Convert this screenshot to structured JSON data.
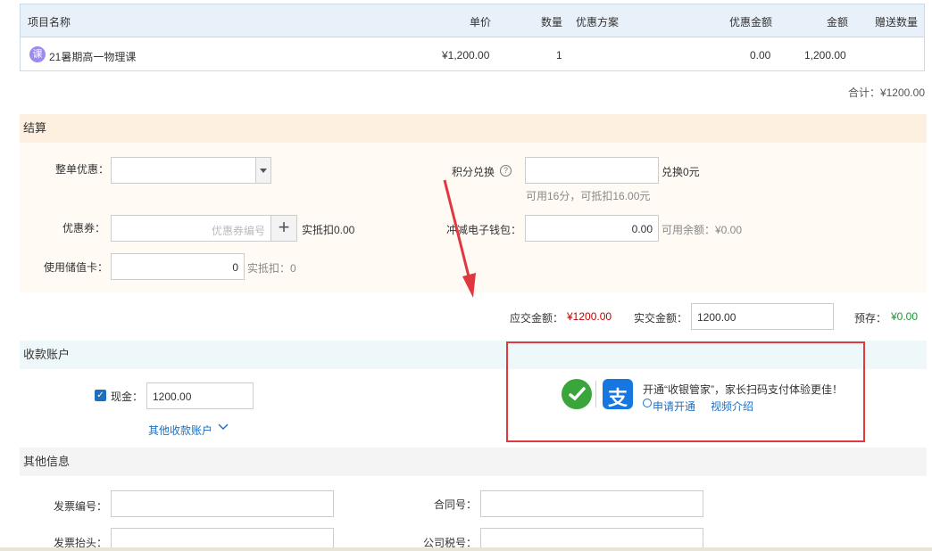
{
  "table": {
    "headers": {
      "name": "项目名称",
      "price": "单价",
      "qty": "数量",
      "promo": "优惠方案",
      "discount": "优惠金额",
      "amount": "金额",
      "gift": "赠送数量"
    },
    "rows": [
      {
        "icon_text": "课",
        "name": "21暑期高一物理课",
        "price": "¥1,200.00",
        "qty": "1",
        "promo": "",
        "discount": "0.00",
        "amount": "1,200.00",
        "gift": ""
      }
    ],
    "total": "合计：¥1200.00"
  },
  "settle": {
    "title": "结算",
    "whole_discount_label": "整单优惠：",
    "points_label": "积分兑换",
    "points_help": "?",
    "points_exchange": "兑换0元",
    "points_hint": "可用16分，可抵扣16.00元",
    "coupon_label": "优惠券：",
    "coupon_placeholder": "优惠券编号",
    "coupon_plus": "+",
    "coupon_deduct": "实抵扣0.00",
    "wallet_label": "冲减电子钱包：",
    "wallet_value": "0.00",
    "wallet_hint": "可用余额：¥0.00",
    "stored_card_label": "使用储值卡：",
    "stored_card_value": "0",
    "stored_card_deduct": "实抵扣：0"
  },
  "summary": {
    "due_label": "应交金额：",
    "due_value": "¥1200.00",
    "paid_label": "实交金额：",
    "paid_value": "1200.00",
    "prepay_label": "预存：",
    "prepay_value": "¥0.00"
  },
  "account": {
    "title": "收款账户",
    "cash_checked": "✓",
    "cash_label": "现金：",
    "cash_value": "1200.00",
    "other_link": "其他收款账户"
  },
  "promo": {
    "text": "开通“收银管家”，家长扫码支付体验更佳！",
    "apply_link": "申请开通",
    "video_link": "视频介绍",
    "alipay_glyph": "支"
  },
  "other": {
    "title": "其他信息",
    "invoice_no_label": "发票编号：",
    "contract_no_label": "合同号：",
    "invoice_title_label": "发票抬头：",
    "tax_no_label": "公司税号："
  },
  "colors": {
    "accent": "#1e6fc0",
    "due": "#c40000",
    "prepay": "#1a9a36",
    "annotation": "#e0383e"
  }
}
